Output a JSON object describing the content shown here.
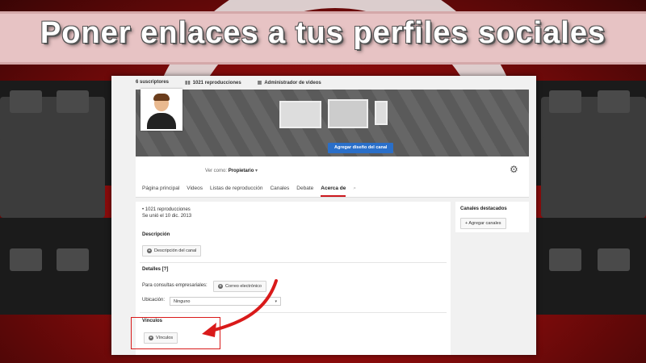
{
  "banner": {
    "title": "Poner enlaces a tus perfiles sociales"
  },
  "channel": {
    "stats": {
      "subscribers": "6 suscriptores",
      "views": "1021 reproducciones",
      "admin": "Administrador de videos"
    },
    "add_art_button": "Agregar diseño del canal",
    "view_as_label": "Ver como:",
    "view_as_value": "Propietario",
    "tabs": [
      {
        "label": "Página principal"
      },
      {
        "label": "Videos"
      },
      {
        "label": "Listas de reproducción"
      },
      {
        "label": "Canales"
      },
      {
        "label": "Debate"
      },
      {
        "label": "Acerca de",
        "active": true
      }
    ]
  },
  "about": {
    "views": "• 1021 reproducciones",
    "joined": "Se unió el 10 dic. 2013",
    "description_title": "Descripción",
    "description_button": "Descripción del canal",
    "details_title": "Detalles [?]",
    "business_label": "Para consultas empresariales:",
    "email_button": "Correo electrónico",
    "location_label": "Ubicación:",
    "location_value": "Ninguno",
    "links_title": "Vínculos",
    "links_button": "Vínculos"
  },
  "sidebar": {
    "featured_title": "Canales destacados",
    "add_channels_button": "+ Agregar canales"
  },
  "colors": {
    "accent_red": "#cc181e",
    "annotation_red": "#d91a1a",
    "primary_blue": "#2a6fc9"
  }
}
